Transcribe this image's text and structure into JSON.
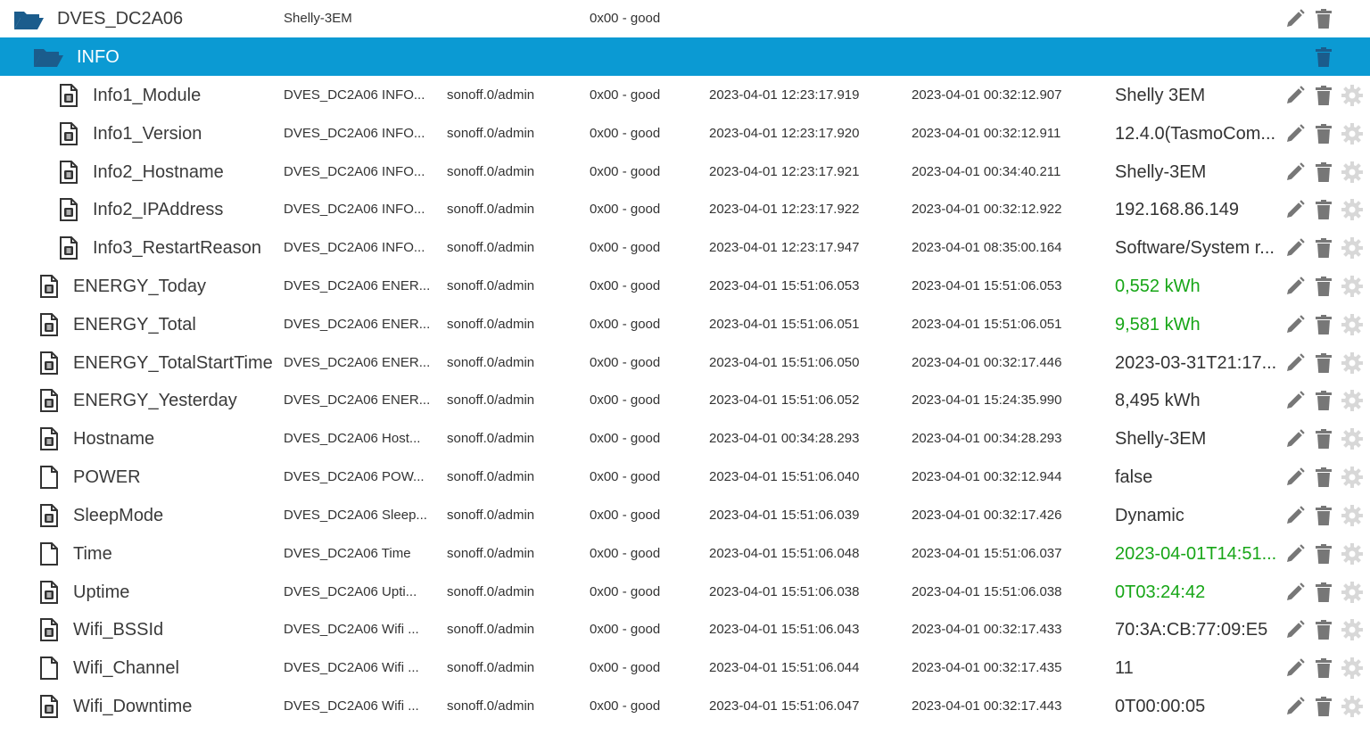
{
  "colors": {
    "selected_row": "#0b9ad3",
    "folder_icon": "#1b5c8c",
    "green_value": "#17a617",
    "action_icon": "#777777",
    "gear_icon": "#d8d8d8"
  },
  "device": {
    "name": "DVES_DC2A06",
    "role": "Shelly-3EM",
    "status": "0x00 - good"
  },
  "channel": {
    "name": "INFO"
  },
  "rows": [
    {
      "name": "Info1_Module",
      "icon": "state-file-icon",
      "desc": "DVES_DC2A06 INFO...",
      "from": "sonoff.0/admin",
      "quality": "0x00 - good",
      "ts": "2023-04-01 12:23:17.919",
      "lc": "2023-04-01 00:32:12.907",
      "value": "Shelly 3EM",
      "green": false
    },
    {
      "name": "Info1_Version",
      "icon": "state-file-icon",
      "desc": "DVES_DC2A06 INFO...",
      "from": "sonoff.0/admin",
      "quality": "0x00 - good",
      "ts": "2023-04-01 12:23:17.920",
      "lc": "2023-04-01 00:32:12.911",
      "value": "12.4.0(TasmoCom...",
      "green": false
    },
    {
      "name": "Info2_Hostname",
      "icon": "state-file-icon",
      "desc": "DVES_DC2A06 INFO...",
      "from": "sonoff.0/admin",
      "quality": "0x00 - good",
      "ts": "2023-04-01 12:23:17.921",
      "lc": "2023-04-01 00:34:40.211",
      "value": "Shelly-3EM",
      "green": false
    },
    {
      "name": "Info2_IPAddress",
      "icon": "state-file-icon",
      "desc": "DVES_DC2A06 INFO...",
      "from": "sonoff.0/admin",
      "quality": "0x00 - good",
      "ts": "2023-04-01 12:23:17.922",
      "lc": "2023-04-01 00:32:12.922",
      "value": "192.168.86.149",
      "green": false
    },
    {
      "name": "Info3_RestartReason",
      "icon": "state-file-icon",
      "desc": "DVES_DC2A06 INFO...",
      "from": "sonoff.0/admin",
      "quality": "0x00 - good",
      "ts": "2023-04-01 12:23:17.947",
      "lc": "2023-04-01 08:35:00.164",
      "value": "Software/System r...",
      "green": false
    },
    {
      "name": "ENERGY_Today",
      "icon": "state-file-icon",
      "desc": "DVES_DC2A06 ENER...",
      "from": "sonoff.0/admin",
      "quality": "0x00 - good",
      "ts": "2023-04-01 15:51:06.053",
      "lc": "2023-04-01 15:51:06.053",
      "value": "0,552 kWh",
      "green": true
    },
    {
      "name": "ENERGY_Total",
      "icon": "state-file-icon",
      "desc": "DVES_DC2A06 ENER...",
      "from": "sonoff.0/admin",
      "quality": "0x00 - good",
      "ts": "2023-04-01 15:51:06.051",
      "lc": "2023-04-01 15:51:06.051",
      "value": "9,581 kWh",
      "green": true
    },
    {
      "name": "ENERGY_TotalStartTime",
      "icon": "state-file-icon",
      "desc": "DVES_DC2A06 ENER...",
      "from": "sonoff.0/admin",
      "quality": "0x00 - good",
      "ts": "2023-04-01 15:51:06.050",
      "lc": "2023-04-01 00:32:17.446",
      "value": "2023-03-31T21:17...",
      "green": false
    },
    {
      "name": "ENERGY_Yesterday",
      "icon": "state-file-icon",
      "desc": "DVES_DC2A06 ENER...",
      "from": "sonoff.0/admin",
      "quality": "0x00 - good",
      "ts": "2023-04-01 15:51:06.052",
      "lc": "2023-04-01 15:24:35.990",
      "value": "8,495 kWh",
      "green": false
    },
    {
      "name": "Hostname",
      "icon": "state-file-icon",
      "desc": "DVES_DC2A06 Host...",
      "from": "sonoff.0/admin",
      "quality": "0x00 - good",
      "ts": "2023-04-01 00:34:28.293",
      "lc": "2023-04-01 00:34:28.293",
      "value": "Shelly-3EM",
      "green": false
    },
    {
      "name": "POWER",
      "icon": "file-icon",
      "desc": "DVES_DC2A06 POW...",
      "from": "sonoff.0/admin",
      "quality": "0x00 - good",
      "ts": "2023-04-01 15:51:06.040",
      "lc": "2023-04-01 00:32:12.944",
      "value": "false",
      "green": false
    },
    {
      "name": "SleepMode",
      "icon": "state-file-icon",
      "desc": "DVES_DC2A06 Sleep...",
      "from": "sonoff.0/admin",
      "quality": "0x00 - good",
      "ts": "2023-04-01 15:51:06.039",
      "lc": "2023-04-01 00:32:17.426",
      "value": "Dynamic",
      "green": false
    },
    {
      "name": "Time",
      "icon": "file-icon",
      "desc": "DVES_DC2A06 Time",
      "from": "sonoff.0/admin",
      "quality": "0x00 - good",
      "ts": "2023-04-01 15:51:06.048",
      "lc": "2023-04-01 15:51:06.037",
      "value": "2023-04-01T14:51...",
      "green": true
    },
    {
      "name": "Uptime",
      "icon": "state-file-icon",
      "desc": "DVES_DC2A06 Upti...",
      "from": "sonoff.0/admin",
      "quality": "0x00 - good",
      "ts": "2023-04-01 15:51:06.038",
      "lc": "2023-04-01 15:51:06.038",
      "value": "0T03:24:42",
      "green": true
    },
    {
      "name": "Wifi_BSSId",
      "icon": "state-file-icon",
      "desc": "DVES_DC2A06 Wifi ...",
      "from": "sonoff.0/admin",
      "quality": "0x00 - good",
      "ts": "2023-04-01 15:51:06.043",
      "lc": "2023-04-01 00:32:17.433",
      "value": "70:3A:CB:77:09:E5",
      "green": false
    },
    {
      "name": "Wifi_Channel",
      "icon": "file-icon",
      "desc": "DVES_DC2A06 Wifi ...",
      "from": "sonoff.0/admin",
      "quality": "0x00 - good",
      "ts": "2023-04-01 15:51:06.044",
      "lc": "2023-04-01 00:32:17.435",
      "value": "11",
      "green": false
    },
    {
      "name": "Wifi_Downtime",
      "icon": "state-file-icon",
      "desc": "DVES_DC2A06 Wifi ...",
      "from": "sonoff.0/admin",
      "quality": "0x00 - good",
      "ts": "2023-04-01 15:51:06.047",
      "lc": "2023-04-01 00:32:17.443",
      "value": "0T00:00:05",
      "green": false
    }
  ]
}
